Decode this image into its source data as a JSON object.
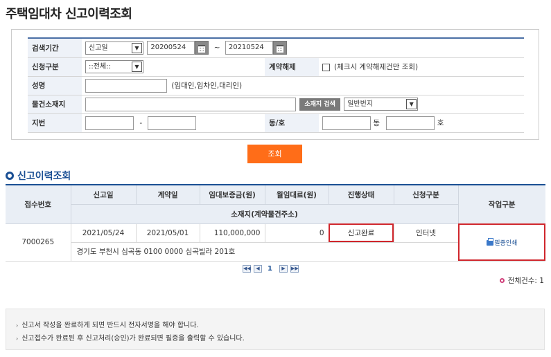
{
  "page": {
    "title": "주택임대차 신고이력조회"
  },
  "search": {
    "period_label": "검색기간",
    "date_type": "신고일",
    "date_from": "20200524",
    "tilde": "~",
    "date_to": "20210524",
    "apply_type_label": "신청구분",
    "apply_type": "::전체::",
    "cancel_label": "계약해제",
    "cancel_hint": "(체크시 계약해제건만 조회)",
    "name_label": "성명",
    "name_value": "",
    "name_hint": "(임대인,임차인,대리인)",
    "address_label": "물건소재지",
    "address_value": "",
    "address_search_btn": "소재지 검색",
    "lot_type": "일반번지",
    "lot_label": "지번",
    "lot_main": "",
    "lot_dash": "-",
    "lot_sub": "",
    "dong_ho_label": "동/호",
    "dong_value": "",
    "dong_suffix": "동",
    "ho_value": "",
    "ho_suffix": "호"
  },
  "query_button": "조회",
  "results": {
    "title": "신고이력조회",
    "headers": {
      "receipt_no": "접수번호",
      "report_date": "신고일",
      "contract_date": "계약일",
      "deposit": "임대보증금(원)",
      "monthly_rent": "월임대료(원)",
      "status": "진행상태",
      "apply_type": "신청구분",
      "address": "소재지(계약물건주소)",
      "action": "작업구분"
    },
    "rows": [
      {
        "receipt_no": "7000265",
        "report_date": "2021/05/24",
        "contract_date": "2021/05/01",
        "deposit": "110,000,000",
        "monthly_rent": "0",
        "status": "신고완료",
        "apply_type": "인터넷",
        "address": "경기도 부천시 심곡동 0100 0000 심곡빌라 201호",
        "action": "필증인쇄"
      }
    ]
  },
  "pagination": {
    "current": "1",
    "first": "◀◀",
    "prev": "◀",
    "next": "▶",
    "last": "▶▶"
  },
  "total": "전체건수: 1",
  "notices": [
    "신고서 작성을 완료하게 되면 반드시 전자서명을 해야 합니다.",
    "신고접수가 완료된 후 신고처리(승인)가 완료되면 필증을 출력할 수 있습니다."
  ]
}
